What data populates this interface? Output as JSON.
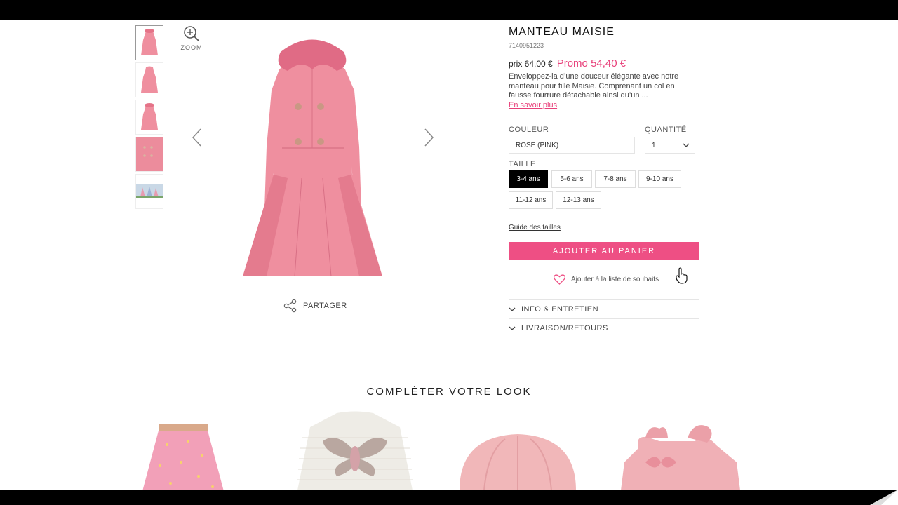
{
  "zoom_label": "ZOOM",
  "product": {
    "title": "MANTEAU MAISIE",
    "sku": "7140951223",
    "price_label": "prix 64,00 €",
    "promo_label": "Promo 54,40 €",
    "description": "Enveloppez-la d’une douceur élégante avec notre manteau pour fille Maisie. Comprenant un col en fausse fourrure détachable ainsi qu’un ...",
    "more_link": "En savoir plus"
  },
  "options": {
    "color_label": "COULEUR",
    "color_value": "ROSE (PINK)",
    "qty_label": "QUANTITÉ",
    "qty_value": "1",
    "size_label": "TAILLE",
    "sizes": [
      "3-4 ans",
      "5-6 ans",
      "7-8 ans",
      "9-10 ans",
      "11-12 ans",
      "12-13 ans"
    ],
    "selected_size": "3-4 ans"
  },
  "size_guide": "Guide des tailles",
  "add_to_cart": "AJOUTER AU PANIER",
  "wishlist": "Ajouter à la liste de souhaits",
  "accordions": [
    "INFO & ENTRETIEN",
    "LIVRAISON/RETOURS"
  ],
  "share_label": "PARTAGER",
  "complete_look": "COMPLÉTER VOTRE LOOK",
  "colors": {
    "accent": "#ee4f84",
    "promo": "#e8407a",
    "coat": "#ef8f9f",
    "selected_size_bg": "#000000"
  },
  "icons": [
    "zoom-icon",
    "chevron-left-icon",
    "chevron-right-icon",
    "share-icon",
    "heart-icon",
    "chevron-down-icon",
    "hand-cursor-icon"
  ]
}
